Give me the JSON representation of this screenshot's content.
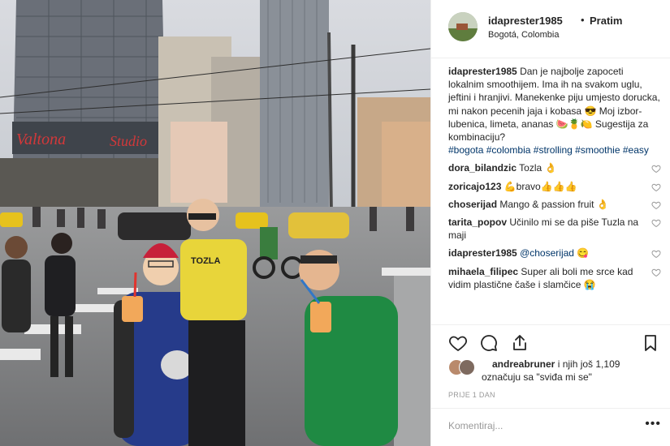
{
  "header": {
    "username": "idaprester1985",
    "separator": "•",
    "follow_label": "Pratim",
    "location": "Bogotá, Colombia"
  },
  "caption": {
    "username": "idaprester1985",
    "text": "Dan je najbolje zapoceti lokalnim smoothijem. Ima ih na svakom uglu, jeftini i hranjivi. Manekenke piju umjesto dorucka, mi nakon pecenih jaja i kobasa 😎 Moj izbor- lubenica, limeta, ananas 🍉🍍🍋 Sugestija za kombinaciju?",
    "hashtags": [
      "#bogota",
      "#colombia",
      "#strolling",
      "#smoothie",
      "#easy"
    ]
  },
  "comments": [
    {
      "username": "dora_bilandzic",
      "text": "Tozla 👌"
    },
    {
      "username": "zoricajo123",
      "text": "💪bravo👍👍👍"
    },
    {
      "username": "choserijad",
      "text": "Mango & passion fruit 👌"
    },
    {
      "username": "tarita_popov",
      "text": "Učinilo mi se da piše Tuzla na maji"
    },
    {
      "username": "idaprester1985",
      "text": "@choserijad 😋"
    },
    {
      "username": "mihaela_filipec",
      "text": "Super ali boli me srce kad vidim plastične čaše i slamčice 😭"
    }
  ],
  "likes": {
    "line1_user": "andreabruner",
    "line1_rest": " i njih još 1,109",
    "line2": "označuju sa \"sviđa mi se\""
  },
  "date": "PRIJE 1 DAN",
  "add_comment": {
    "placeholder": "Komentiraj...",
    "more_label": "•••"
  },
  "icons": [
    "heart-icon",
    "comment-icon",
    "share-icon",
    "bookmark-icon",
    "small-heart-icon"
  ],
  "colors": {
    "hashtag": "#003569",
    "border": "#efefef",
    "muted": "#999999"
  }
}
